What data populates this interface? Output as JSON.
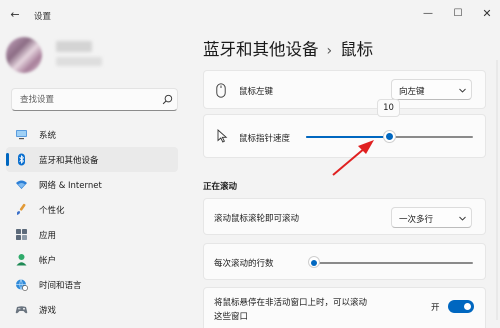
{
  "window": {
    "title": "设置",
    "controls": {
      "minimize": "—",
      "maximize": "☐",
      "close": "✕"
    },
    "back": "←"
  },
  "search": {
    "placeholder": "查找设置"
  },
  "nav": {
    "items": [
      {
        "label": "系统",
        "icon": "monitor-icon"
      },
      {
        "label": "蓝牙和其他设备",
        "icon": "bluetooth-icon",
        "active": true
      },
      {
        "label": "网络 & Internet",
        "icon": "wifi-icon"
      },
      {
        "label": "个性化",
        "icon": "brush-icon"
      },
      {
        "label": "应用",
        "icon": "apps-icon"
      },
      {
        "label": "帐户",
        "icon": "person-icon"
      },
      {
        "label": "时间和语言",
        "icon": "globe-clock-icon"
      },
      {
        "label": "游戏",
        "icon": "gamepad-icon"
      }
    ]
  },
  "header": {
    "parent": "蓝牙和其他设备",
    "separator": "›",
    "current": "鼠标"
  },
  "settings": {
    "primary_button": {
      "label": "鼠标左键",
      "value": "向左键"
    },
    "pointer_speed": {
      "label": "鼠标指针速度",
      "value": 10,
      "max": 20,
      "tooltip": "10"
    },
    "scrolling_section": "正在滚动",
    "wheel_scroll": {
      "label": "滚动鼠标滚轮即可滚动",
      "value": "一次多行"
    },
    "lines_per_scroll": {
      "label": "每次滚动的行数",
      "value": 3,
      "max": 100
    },
    "inactive_scroll": {
      "label_line1": "将鼠标悬停在非活动窗口上时，可以滚动",
      "label_line2": "这些窗口",
      "state": "开",
      "on": true
    }
  },
  "colors": {
    "accent": "#0067c0",
    "annotation": "#e02020"
  }
}
